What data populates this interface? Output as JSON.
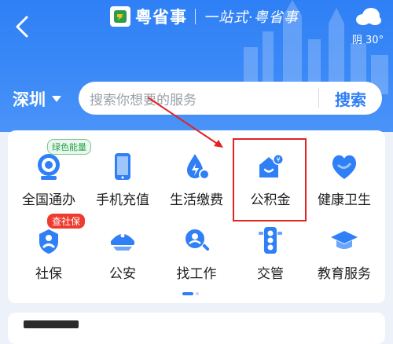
{
  "header": {
    "back_icon": "back-chevron-icon",
    "app_name": "粤省事",
    "slogan": "一站式·粤省事",
    "weather": {
      "icon": "cloud-icon",
      "text": "阴 30°"
    },
    "bg_color": "#2f80f6"
  },
  "location": {
    "city": "深圳"
  },
  "search": {
    "placeholder": "搜索你想要的服务",
    "button": "搜索"
  },
  "services": [
    {
      "label": "全国通办",
      "icon": "nationwide-service-icon",
      "badge": "绿色能量"
    },
    {
      "label": "手机充值",
      "icon": "phone-recharge-icon"
    },
    {
      "label": "生活缴费",
      "icon": "utility-payment-icon"
    },
    {
      "label": "公积金",
      "icon": "housing-fund-icon"
    },
    {
      "label": "健康卫生",
      "icon": "health-heart-icon"
    },
    {
      "label": "社保",
      "icon": "social-security-icon",
      "badge": "查社保"
    },
    {
      "label": "公安",
      "icon": "police-cap-icon"
    },
    {
      "label": "找工作",
      "icon": "job-search-icon"
    },
    {
      "label": "交管",
      "icon": "traffic-light-icon"
    },
    {
      "label": "教育服务",
      "icon": "education-cap-icon"
    }
  ],
  "pager": {
    "total": 2,
    "active": 1
  },
  "accent_color": "#2f7ff6",
  "annotation_color": "#e32222"
}
